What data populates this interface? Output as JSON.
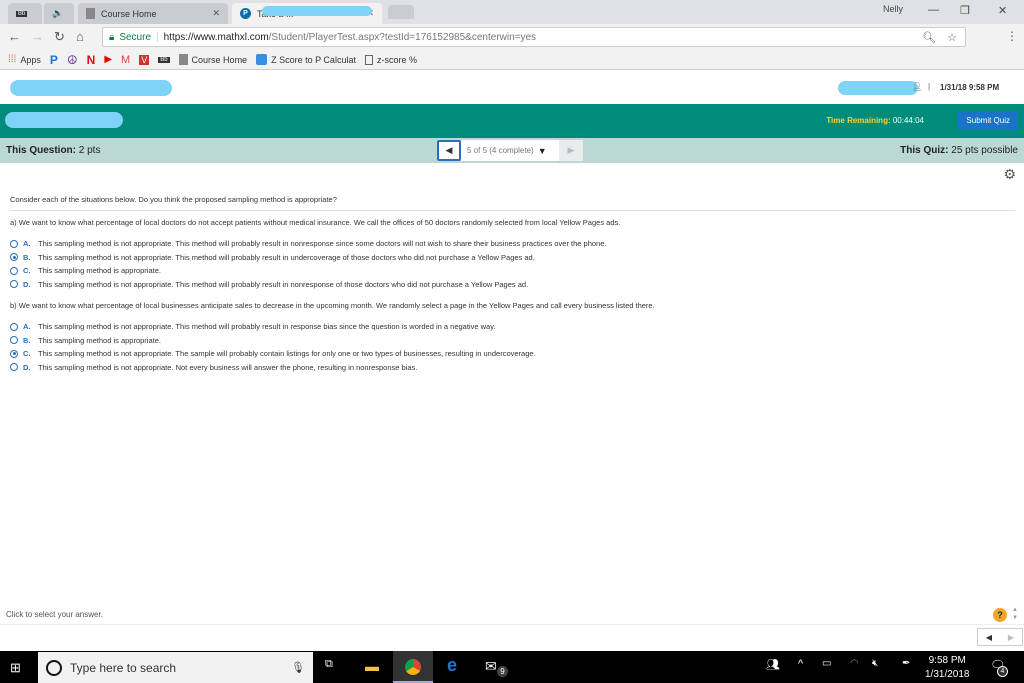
{
  "browser": {
    "tabs": [
      {
        "label": "",
        "icon": "blackboard-icon"
      },
      {
        "label": "",
        "icon": "speaker-icon"
      },
      {
        "label": "Course Home",
        "icon": "page-icon"
      },
      {
        "label": "Take a ...",
        "icon": "pearson-icon"
      }
    ],
    "profile_name": "Nelly",
    "secure_label": "Secure",
    "url_host": "https://www.mathxl.com",
    "url_path": "/Student/PlayerTest.aspx?testId=176152985&centerwin=yes",
    "bookmarks": [
      {
        "label": "Apps",
        "icon": "apps-grid-icon"
      },
      {
        "label": "",
        "icon": "pandora-icon"
      },
      {
        "label": "",
        "icon": "peace-icon"
      },
      {
        "label": "",
        "icon": "netflix-icon"
      },
      {
        "label": "",
        "icon": "youtube-icon"
      },
      {
        "label": "",
        "icon": "gmail-icon"
      },
      {
        "label": "",
        "icon": "vocab-icon"
      },
      {
        "label": "",
        "icon": "blackboard-icon"
      },
      {
        "label": "Course Home",
        "icon": "page-icon"
      },
      {
        "label": "Z Score to P  Calculat",
        "icon": "calculator-icon"
      },
      {
        "label": "z-score %",
        "icon": "document-icon"
      }
    ]
  },
  "header": {
    "datetime": "1/31/18 9:58 PM",
    "time_remaining_label": "Time Remaining:",
    "time_remaining_value": "00:44:04",
    "submit_label": "Submit Quiz"
  },
  "question_bar": {
    "this_question_label": "This Question:",
    "this_question_value": "2 pts",
    "pager_text": "5 of 5 (4 complete)",
    "this_quiz_label": "This Quiz:",
    "this_quiz_value": "25 pts possible"
  },
  "content": {
    "intro": "Consider each of the situations below. Do you think the proposed sampling method is appropriate?",
    "parts": [
      {
        "question": "a) We want to know what percentage of local doctors do not accept patients without medical insurance. We call the offices of 50 doctors randomly selected from local Yellow Pages ads.",
        "options": [
          {
            "letter": "A.",
            "text": "This sampling method is not appropriate. This method will probably result in nonresponse since some doctors will not wish to share their business practices over the phone.",
            "selected": false
          },
          {
            "letter": "B.",
            "text": "This sampling method is not appropriate. This method will probably result in undercoverage of those doctors who did not purchase a Yellow Pages ad.",
            "selected": true
          },
          {
            "letter": "C.",
            "text": "This sampling method is appropriate.",
            "selected": false
          },
          {
            "letter": "D.",
            "text": "This sampling method is not appropriate. This method will probably result in nonresponse of those doctors who did not purchase a Yellow Pages ad.",
            "selected": false
          }
        ]
      },
      {
        "question": "b) We want to know what percentage of local businesses anticipate sales to decrease in the upcoming month. We randomly select a page in the Yellow Pages and call every business listed there.",
        "options": [
          {
            "letter": "A.",
            "text": "This sampling method is not appropriate. This method will probably result in response bias since the question is worded in a negative way.",
            "selected": false
          },
          {
            "letter": "B.",
            "text": "This sampling method is appropriate.",
            "selected": false
          },
          {
            "letter": "C.",
            "text": "This sampling method is not appropriate. The sample will probably contain listings for only one or two types of businesses, resulting in undercoverage.",
            "selected": true
          },
          {
            "letter": "D.",
            "text": "This sampling method is not appropriate. Not every business will answer the phone, resulting in nonresponse bias.",
            "selected": false
          }
        ]
      }
    ],
    "footer_hint": "Click to select your answer."
  },
  "taskbar": {
    "search_placeholder": "Type here to search",
    "mail_badge": "9",
    "time": "9:58 PM",
    "date": "1/31/2018",
    "notification_count": "4"
  },
  "colors": {
    "green_bar": "#008c7a",
    "question_bar": "#bcd8d5",
    "submit_button": "#1a73c8",
    "time_label": "#f5d442",
    "radio_accent": "#2a6ebd"
  }
}
